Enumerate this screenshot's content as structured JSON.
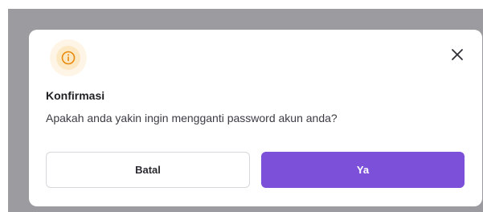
{
  "dialog": {
    "title": "Konfirmasi",
    "message": "Apakah anda yakin ingin mengganti password akun anda?",
    "cancel_label": "Batal",
    "confirm_label": "Ya",
    "icon": "info-icon",
    "close_icon": "close-icon"
  },
  "colors": {
    "accent": "#7d50d9",
    "info": "#e8890c",
    "overlay": "#9c9ca0"
  }
}
